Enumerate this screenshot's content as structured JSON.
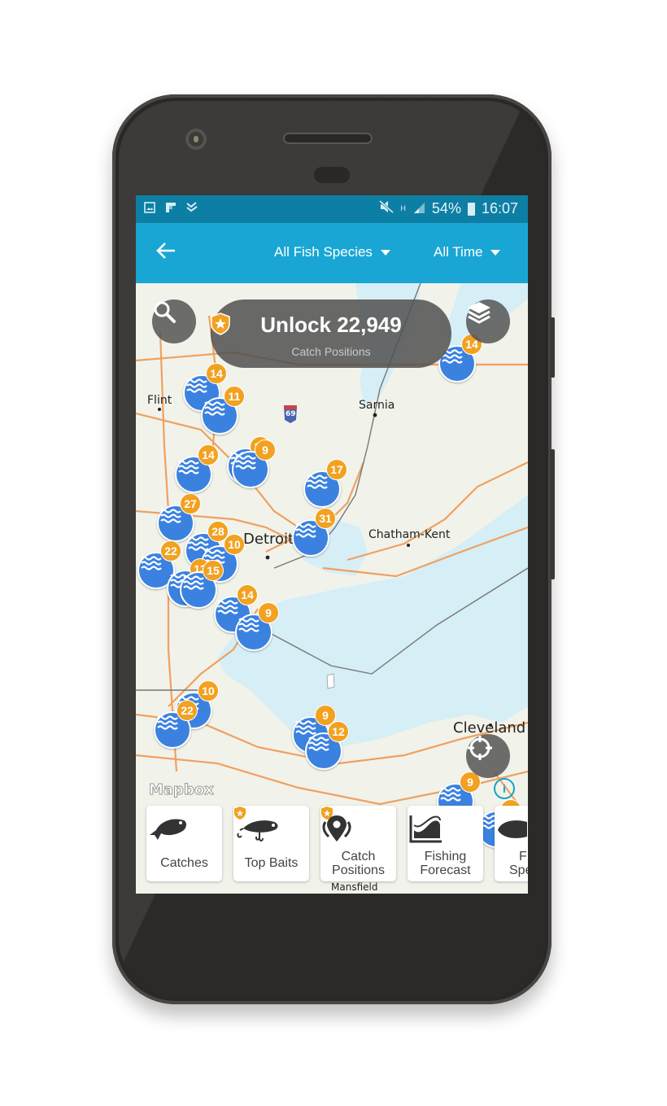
{
  "status_bar": {
    "left_icons": [
      "image-icon",
      "flipboard-icon",
      "check-icon"
    ],
    "right_icons": [
      "mute-icon",
      "h-signal-icon",
      "r-signal-icon"
    ],
    "battery": "54%",
    "time": "16:07"
  },
  "app_bar": {
    "back_icon": "arrow-left-icon",
    "species_filter": "All Fish Species",
    "time_filter": "All Time"
  },
  "map": {
    "unlock": {
      "title": "Unlock 22,949",
      "subtitle": "Catch Positions",
      "icon": "pro-shield-star-icon"
    },
    "search_icon": "search-icon",
    "layers_icon": "layers-icon",
    "locate_icon": "crosshair-icon",
    "attribution": "Mapbox",
    "info_icon": "i",
    "labels": [
      {
        "text": "Flint",
        "size": "normal"
      },
      {
        "text": "Sarnia",
        "size": "normal"
      },
      {
        "text": "Detroit",
        "size": "big"
      },
      {
        "text": "Chatham-Kent",
        "size": "normal"
      },
      {
        "text": "Cleveland",
        "size": "big"
      },
      {
        "text": "Mansfield",
        "size": "normal"
      },
      {
        "text": "69",
        "size": "shield"
      }
    ],
    "clusters": [
      {
        "count": "14"
      },
      {
        "count": "11"
      },
      {
        "count": "14"
      },
      {
        "count": "12"
      },
      {
        "count": "9"
      },
      {
        "count": "17"
      },
      {
        "count": "27"
      },
      {
        "count": "31"
      },
      {
        "count": "28"
      },
      {
        "count": "10"
      },
      {
        "count": "22"
      },
      {
        "count": "13"
      },
      {
        "count": "15"
      },
      {
        "count": "14"
      },
      {
        "count": "9"
      },
      {
        "count": "10"
      },
      {
        "count": "22"
      },
      {
        "count": "9"
      },
      {
        "count": "12"
      },
      {
        "count": "9"
      },
      {
        "count": "9"
      },
      {
        "count": "14"
      }
    ]
  },
  "cards": [
    {
      "label1": "Catches",
      "label2": "",
      "icon": "fish-icon",
      "pro": false
    },
    {
      "label1": "Top Baits",
      "label2": "",
      "icon": "lure-icon",
      "pro": true
    },
    {
      "label1": "Catch",
      "label2": "Positions",
      "icon": "location-pin-icon",
      "pro": true
    },
    {
      "label1": "Fishing",
      "label2": "Forecast",
      "icon": "forecast-chart-icon",
      "pro": false
    },
    {
      "label1": "F",
      "label2": "Spe",
      "icon": "fish-species-icon",
      "pro": false
    }
  ]
}
